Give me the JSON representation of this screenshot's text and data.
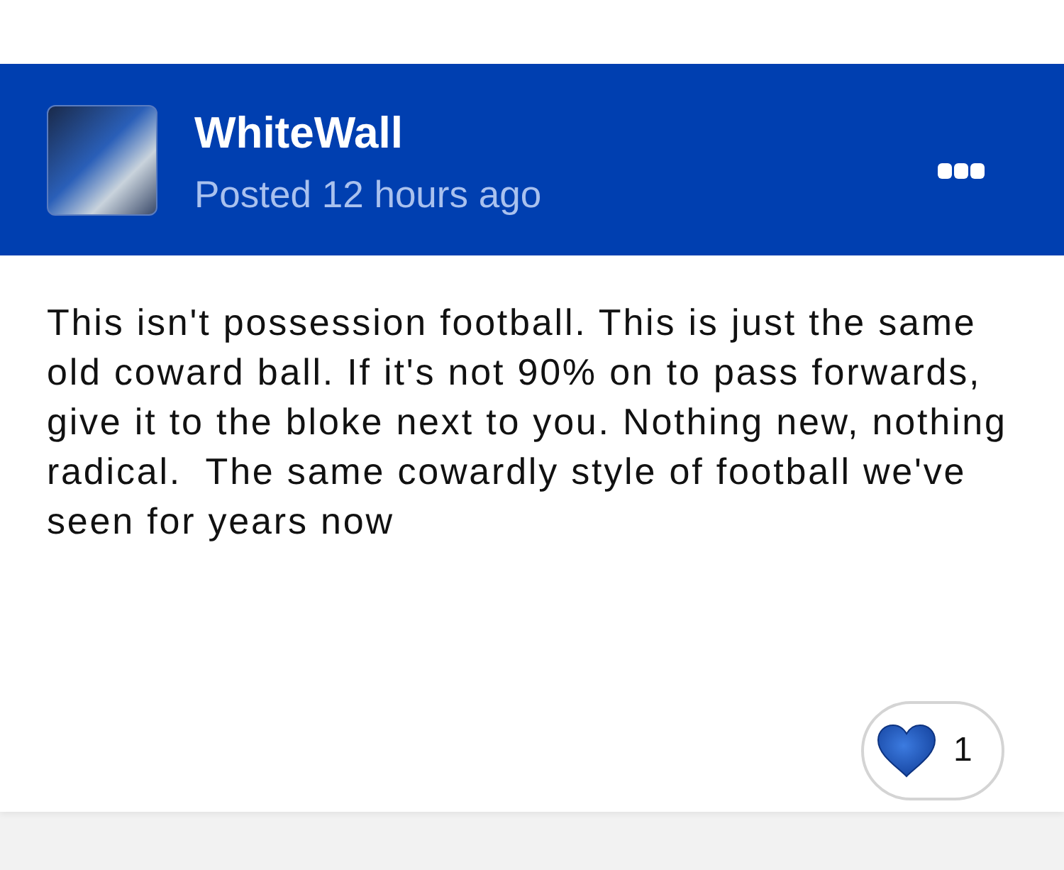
{
  "post": {
    "author": "WhiteWall",
    "posted": "Posted 12 hours ago",
    "body": "This isn't possession football. This is just the same old coward ball. If it's not 90% on to pass forwards, give it to the bloke next to you. Nothing new, nothing radical.  The same cowardly style of football we've seen for years now"
  },
  "reactions": [
    {
      "count": "1"
    }
  ]
}
